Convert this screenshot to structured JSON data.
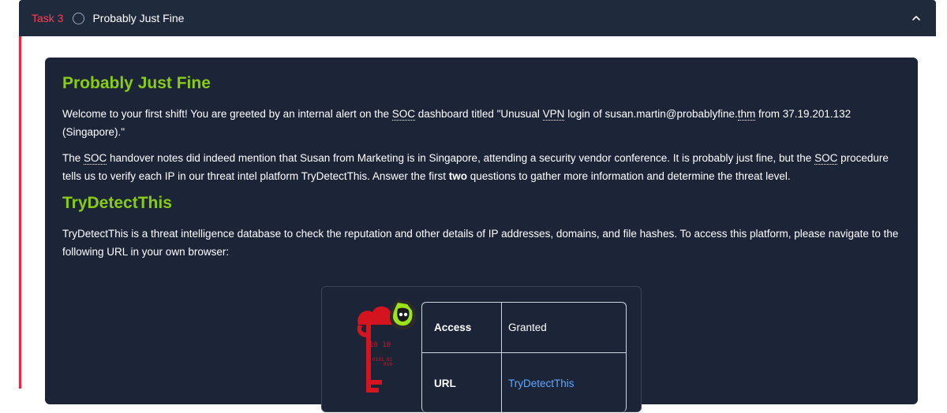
{
  "task": {
    "label": "Task 3",
    "title": "Probably Just Fine"
  },
  "content": {
    "heading1": "Probably Just Fine",
    "p1_a": "Welcome to your first shift! You are greeted by an internal alert on the ",
    "p1_soc": "SOC",
    "p1_b": " dashboard titled \"Unusual ",
    "p1_vpn": "VPN",
    "p1_c": " login of susan.martin@probablyfine.",
    "p1_thm": "thm",
    "p1_d": " from 37.19.201.132 (Singapore).\"",
    "p2_a": "The ",
    "p2_soc1": "SOC",
    "p2_b": " handover notes did indeed mention that Susan from Marketing is in Singapore, attending a security vendor conference. It is probably just fine, but the ",
    "p2_soc2": "SOC",
    "p2_c": " procedure tells us to verify each IP in our threat intel platform TryDetectThis. Answer the first ",
    "p2_bold": "two",
    "p2_d": " questions to gather more information and determine the threat level.",
    "heading2": "TryDetectThis",
    "p3": "TryDetectThis is a threat intelligence database to check the reputation and other details of IP addresses, domains, and file hashes. To access this platform, please navigate to the following URL in your own browser:"
  },
  "info_table": {
    "rows": [
      {
        "key": "Access",
        "value": "Granted"
      },
      {
        "key": "URL",
        "value": "TryDetectThis"
      }
    ]
  },
  "logo": {
    "binary_lines": [
      "10 10",
      "1110",
      "0101 01",
      "010"
    ]
  },
  "colors": {
    "header_bg": "#1f2a3c",
    "card_bg": "#1c2538",
    "accent_red": "#ff1e3c",
    "heading_green": "#88cc14",
    "link_blue": "#5ea8ff"
  }
}
